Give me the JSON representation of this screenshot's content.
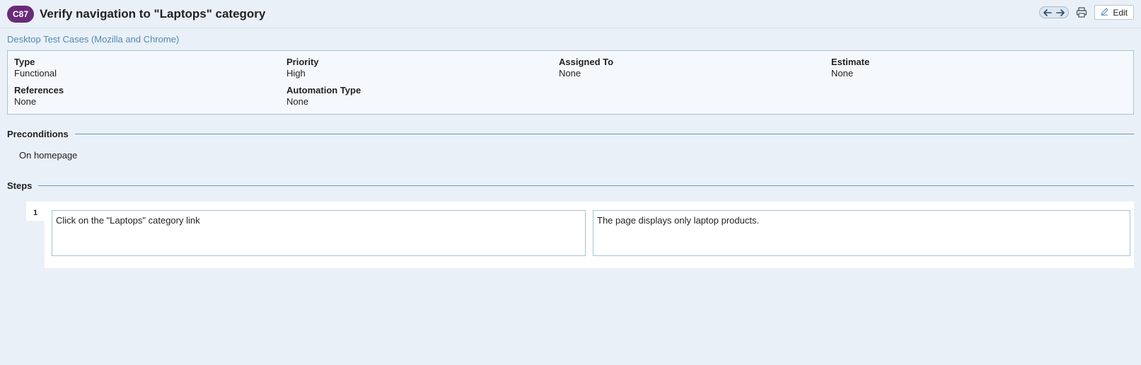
{
  "header": {
    "case_id": "C87",
    "title": "Verify navigation to \"Laptops\" category",
    "edit_label": "Edit"
  },
  "breadcrumb": "Desktop Test Cases (Mozilla and Chrome)",
  "properties": {
    "type_label": "Type",
    "type_value": "Functional",
    "priority_label": "Priority",
    "priority_value": "High",
    "assigned_label": "Assigned To",
    "assigned_value": "None",
    "estimate_label": "Estimate",
    "estimate_value": "None",
    "references_label": "References",
    "references_value": "None",
    "automation_label": "Automation Type",
    "automation_value": "None"
  },
  "preconditions": {
    "title": "Preconditions",
    "text": "On homepage"
  },
  "steps": {
    "title": "Steps",
    "items": [
      {
        "number": "1",
        "action": "Click on the \"Laptops\" category link",
        "expected": "The page displays only laptop products."
      }
    ]
  },
  "icons": {
    "prev": "arrow-left-icon",
    "next": "arrow-right-icon",
    "print": "printer-icon",
    "edit": "pencil-icon"
  },
  "colors": {
    "badge": "#6a2a7a",
    "link": "#4f8bb8",
    "background": "#eaf0f7"
  }
}
